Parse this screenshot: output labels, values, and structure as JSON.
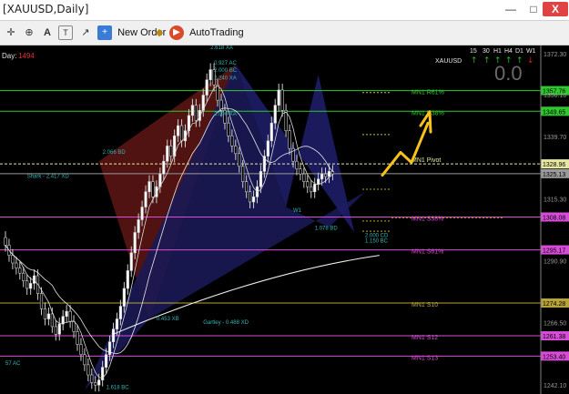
{
  "window": {
    "title": "[XAUUSD,Daily]",
    "controls": {
      "minimize": "—",
      "maximize": "□",
      "close": "X"
    }
  },
  "toolbar": {
    "new_order_label": "New Order",
    "autotrading_label": "AutoTrading"
  },
  "chart": {
    "symbol": "XAUUSD",
    "day_label": "Day:",
    "day_value": "1494",
    "score": "0.0",
    "timeframes": [
      "15",
      "30",
      "H1",
      "H4",
      "D1",
      "W1"
    ],
    "arrows": [
      "up",
      "up",
      "up",
      "up",
      "up",
      "down"
    ],
    "colors": {
      "up_arrow": "#21c121",
      "down_arrow": "#e02020",
      "pivot_line": "#e8e8a0",
      "resistance": "#2ec92e",
      "support": "#d94cd9",
      "s1_line": "#b8a23a",
      "current_price": "#9a9a9a",
      "projection": "#f7c21b"
    },
    "price_axis": [
      {
        "price": 1372.3,
        "label": "1372.30"
      },
      {
        "price": 1356.1,
        "label": "1356.10"
      },
      {
        "price": 1339.7,
        "label": "1339.70"
      },
      {
        "price": 1315.3,
        "label": "1315.30"
      },
      {
        "price": 1290.9,
        "label": "1290.90"
      },
      {
        "price": 1266.5,
        "label": "1266.50"
      },
      {
        "price": 1242.1,
        "label": "1242.10"
      }
    ],
    "levels": [
      {
        "price": 1357.76,
        "label": "1357.76",
        "name": "MN1 R61%",
        "kind": "resistance"
      },
      {
        "price": 1349.65,
        "label": "1349.65",
        "name": "MN1 R38%",
        "kind": "resistance"
      },
      {
        "price": 1328.96,
        "label": "1328.96",
        "name": "MN1 Pivot",
        "kind": "pivot"
      },
      {
        "price": 1325.13,
        "label": "1325.13",
        "name": "",
        "kind": "current"
      },
      {
        "price": 1308.08,
        "label": "1308.08",
        "name": "MN1 S38%",
        "kind": "support"
      },
      {
        "price": 1295.17,
        "label": "1295.17",
        "name": "MN1 S61%",
        "kind": "support"
      },
      {
        "price": 1274.28,
        "label": "1274.28",
        "name": "MN1 S10",
        "kind": "s1"
      },
      {
        "price": 1261.38,
        "label": "1261.38",
        "name": "MN1 S12",
        "kind": "support"
      },
      {
        "price": 1253.4,
        "label": "1253.40",
        "name": "MN1 S13",
        "kind": "support"
      }
    ],
    "pattern_labels": [
      {
        "text": "2.618 XA",
        "price": 1374.0,
        "bar": 57
      },
      {
        "text": "0.927 AC",
        "price": 1368.0,
        "bar": 58
      },
      {
        "text": "2.000 BC",
        "price": 1365.2,
        "bar": 58
      },
      {
        "text": "2.240 XA",
        "price": 1362.0,
        "bar": 58
      },
      {
        "text": "2.000 XA",
        "price": 1348.0,
        "bar": 58
      },
      {
        "text": "Shark - 2.417 XD",
        "price": 1323.5,
        "bar": 6
      },
      {
        "text": "2.066 BD",
        "price": 1333.0,
        "bar": 27
      },
      {
        "text": "W1",
        "price": 1310.0,
        "bar": 80
      },
      {
        "text": "1.078 BD",
        "price": 1303.0,
        "bar": 86
      },
      {
        "text": "2.000 CD",
        "price": 1300.2,
        "bar": 100
      },
      {
        "text": "1.150 BC",
        "price": 1298.0,
        "bar": 100
      },
      {
        "text": "0.453 XB",
        "price": 1267.5,
        "bar": 42
      },
      {
        "text": "Gartley - 0.488 XD",
        "price": 1266.0,
        "bar": 55
      },
      {
        "text": "57 AC",
        "price": 1250.0,
        "bar": 0
      },
      {
        "text": "1.618 BC",
        "price": 1240.5,
        "bar": 28
      }
    ]
  }
}
